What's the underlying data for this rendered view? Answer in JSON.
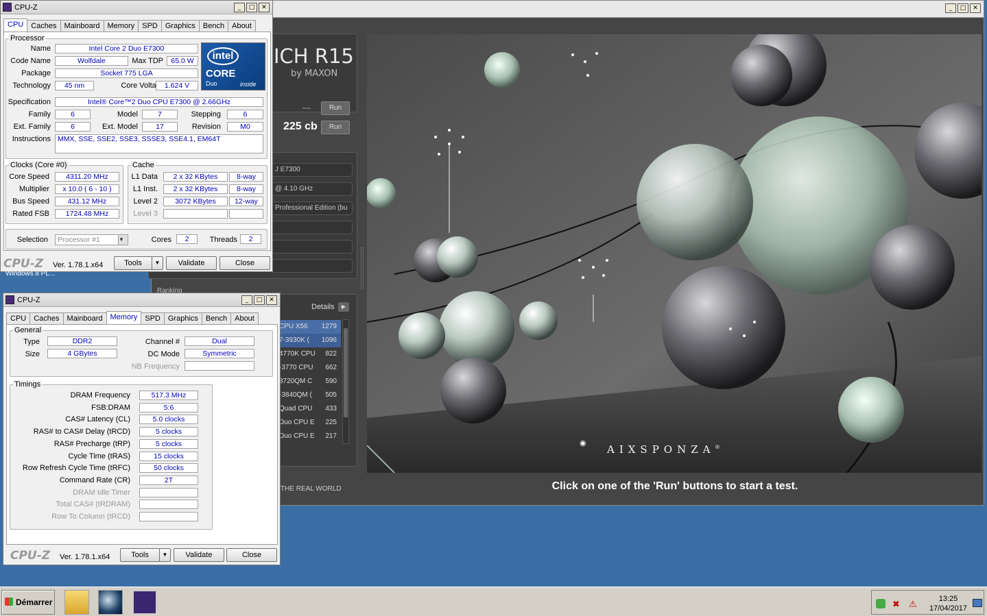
{
  "cinebench": {
    "title_suffix": "ICH R15",
    "by": "by MAXON",
    "gl_score": "---",
    "cpu_score": "225 cb",
    "run_label": "Run",
    "processor": "J E7300",
    "clock": "@ 4.10 GHz",
    "os": "Professional Edition (bu",
    "ranking_label": "Ranking",
    "details_label": "Details",
    "ranking": [
      {
        "name": "CPU X56",
        "score": "1279"
      },
      {
        "name": "7-3930K (",
        "score": "1096"
      },
      {
        "name": "4770K CPU",
        "score": "822"
      },
      {
        "name": "-3770 CPU",
        "score": "662"
      },
      {
        "name": "3720QM C",
        "score": "590"
      },
      {
        "name": "-3840QM (",
        "score": "505"
      },
      {
        "name": "Quad CPU",
        "score": "433"
      },
      {
        "name": "Duo CPU E",
        "score": "225"
      },
      {
        "name": "Duo CPU E",
        "score": "217"
      }
    ],
    "real_world": "THE REAL WORLD",
    "status": "Click on one of the 'Run' buttons to start a test.",
    "brand": "AIXSPONZA",
    "brand_mark": "®"
  },
  "cpuz_cpu": {
    "title": "CPU-Z",
    "tabs": [
      "CPU",
      "Caches",
      "Mainboard",
      "Memory",
      "SPD",
      "Graphics",
      "Bench",
      "About"
    ],
    "processor_legend": "Processor",
    "name_label": "Name",
    "name": "Intel Core 2 Duo E7300",
    "codename_label": "Code Name",
    "codename": "Wolfdale",
    "maxtdp_label": "Max TDP",
    "maxtdp": "65.0 W",
    "package_label": "Package",
    "package": "Socket 775 LGA",
    "tech_label": "Technology",
    "tech": "45 nm",
    "voltage_label": "Core Voltage",
    "voltage": "1.624 V",
    "spec_label": "Specification",
    "spec": "Intel® Core™2 Duo CPU     E7300  @ 2.66GHz",
    "family_label": "Family",
    "family": "6",
    "model_label": "Model",
    "model": "7",
    "stepping_label": "Stepping",
    "stepping": "6",
    "extfamily_label": "Ext. Family",
    "extfamily": "6",
    "extmodel_label": "Ext. Model",
    "extmodel": "17",
    "revision_label": "Revision",
    "revision": "M0",
    "instr_label": "Instructions",
    "instr": "MMX, SSE, SSE2, SSE3, SSSE3, SSE4.1, EM64T",
    "clocks_legend": "Clocks (Core #0)",
    "corespeed_label": "Core Speed",
    "corespeed": "4311.20 MHz",
    "mult_label": "Multiplier",
    "mult": "x 10.0 ( 6 - 10 )",
    "bus_label": "Bus Speed",
    "bus": "431.12 MHz",
    "fsb_label": "Rated FSB",
    "fsb": "1724.48 MHz",
    "cache_legend": "Cache",
    "l1d_label": "L1 Data",
    "l1d": "2 x 32 KBytes",
    "l1d_way": "8-way",
    "l1i_label": "L1 Inst.",
    "l1i": "2 x 32 KBytes",
    "l1i_way": "8-way",
    "l2_label": "Level 2",
    "l2": "3072 KBytes",
    "l2_way": "12-way",
    "l3_label": "Level 3",
    "selection_label": "Selection",
    "selection": "Processor #1",
    "cores_label": "Cores",
    "cores": "2",
    "threads_label": "Threads",
    "threads": "2",
    "logo": "CPU-Z",
    "version": "Ver. 1.78.1.x64",
    "tools": "Tools",
    "validate": "Validate",
    "close": "Close",
    "intel_line1": "intel",
    "intel_line2": "CORE",
    "intel_line3": "Duo",
    "intel_line4": "inside",
    "behind_text": "Windows 8 PL..."
  },
  "cpuz_mem": {
    "title": "CPU-Z",
    "tabs": [
      "CPU",
      "Caches",
      "Mainboard",
      "Memory",
      "SPD",
      "Graphics",
      "Bench",
      "About"
    ],
    "general_legend": "General",
    "type_label": "Type",
    "type": "DDR2",
    "size_label": "Size",
    "size": "4 GBytes",
    "channel_label": "Channel #",
    "channel": "Dual",
    "dcmode_label": "DC Mode",
    "dcmode": "Symmetric",
    "nbfreq_label": "NB Frequency",
    "timings_legend": "Timings",
    "rows": [
      {
        "label": "DRAM Frequency",
        "value": "517.3 MHz",
        "dim": false
      },
      {
        "label": "FSB:DRAM",
        "value": "5:6",
        "dim": false
      },
      {
        "label": "CAS# Latency (CL)",
        "value": "5.0 clocks",
        "dim": false
      },
      {
        "label": "RAS# to CAS# Delay (tRCD)",
        "value": "5 clocks",
        "dim": false
      },
      {
        "label": "RAS# Precharge (tRP)",
        "value": "5 clocks",
        "dim": false
      },
      {
        "label": "Cycle Time (tRAS)",
        "value": "15 clocks",
        "dim": false
      },
      {
        "label": "Row Refresh Cycle Time (tRFC)",
        "value": "50 clocks",
        "dim": false
      },
      {
        "label": "Command Rate (CR)",
        "value": "2T",
        "dim": false
      },
      {
        "label": "DRAM Idle Timer",
        "value": "",
        "dim": true
      },
      {
        "label": "Total CAS# (tRDRAM)",
        "value": "",
        "dim": true
      },
      {
        "label": "Row To Column (tRCD)",
        "value": "",
        "dim": true
      }
    ],
    "logo": "CPU-Z",
    "version": "Ver. 1.78.1.x64",
    "tools": "Tools",
    "validate": "Validate",
    "close": "Close"
  },
  "taskbar": {
    "start": "Démarrer",
    "time": "13:25",
    "date": "17/04/2017"
  },
  "icons": [
    "folder-icon",
    "cinebench-icon",
    "cpuz-icon",
    "network-icon",
    "volume-muted-icon",
    "security-alert-icon",
    "show-desktop-icon"
  ]
}
